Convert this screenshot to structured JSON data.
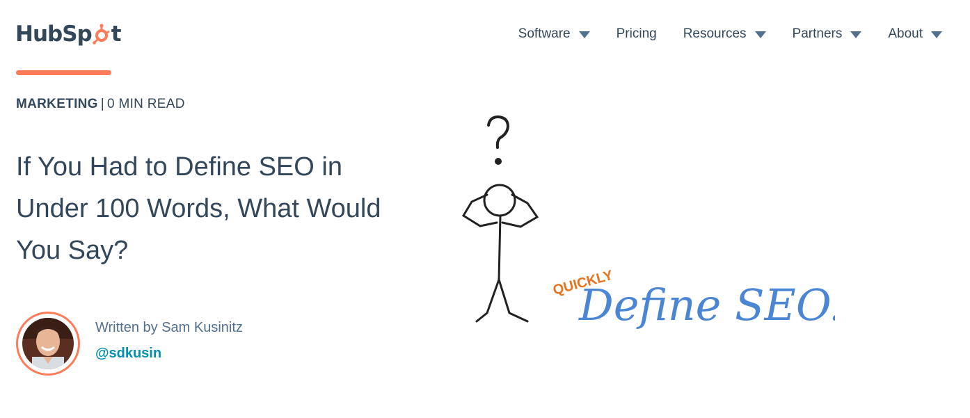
{
  "header": {
    "logo_text_left": "HubSp",
    "logo_text_right": "t",
    "nav": [
      {
        "label": "Software",
        "has_dropdown": true
      },
      {
        "label": "Pricing",
        "has_dropdown": false
      },
      {
        "label": "Resources",
        "has_dropdown": true
      },
      {
        "label": "Partners",
        "has_dropdown": true
      },
      {
        "label": "About",
        "has_dropdown": true
      }
    ]
  },
  "article": {
    "topic": "MARKETING",
    "separator": "|",
    "read_time": "0 MIN READ",
    "title": "If You Had to Define SEO in Under 100 Words, What Would You Say?",
    "author": {
      "written_by": "Written by Sam Kusinitz",
      "handle": "@sdkusin"
    },
    "image": {
      "word_small": "QUICKLY",
      "word_large": "Define SEO."
    }
  },
  "colors": {
    "brand_orange": "#ff7a59",
    "text_dark": "#33475b",
    "link_teal": "#0091ae",
    "image_blue": "#4a86d4",
    "image_orange": "#e8731f"
  }
}
